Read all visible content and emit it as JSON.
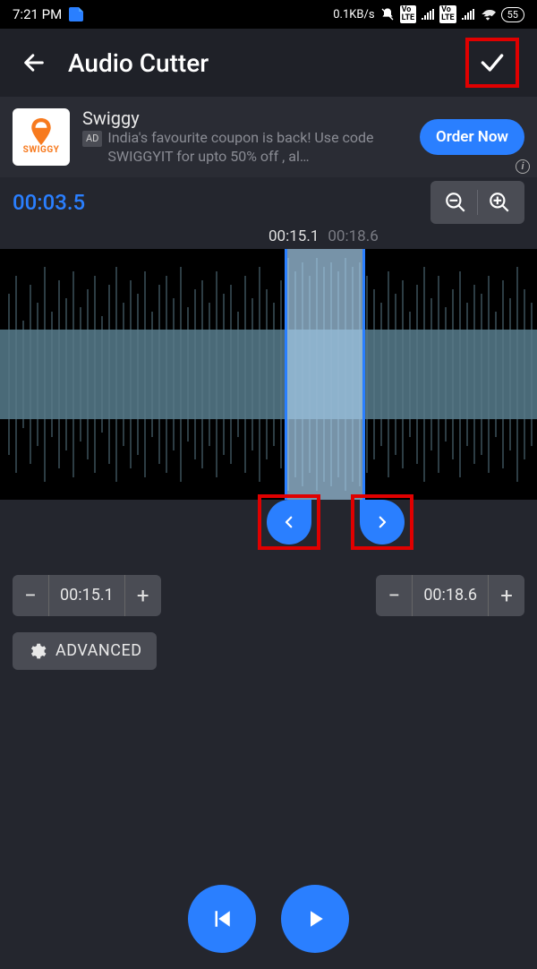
{
  "status": {
    "time": "7:21 PM",
    "data_rate": "0.1KB/s",
    "lte1": "Vo LTE",
    "lte2": "Vo LTE",
    "battery": "55"
  },
  "app": {
    "title": "Audio Cutter"
  },
  "ad": {
    "icon_text": "SWIGGY",
    "title": "Swiggy",
    "badge": "AD",
    "desc": "India's favourite coupon is back! Use code SWIGGYIT for upto 50% off , al…",
    "cta": "Order Now"
  },
  "editor": {
    "selection_duration": "00:03.5",
    "marker_start": "00:15.1",
    "marker_end": "00:18.6",
    "start_value": "00:15.1",
    "end_value": "00:18.6",
    "advanced_label": "ADVANCED"
  }
}
